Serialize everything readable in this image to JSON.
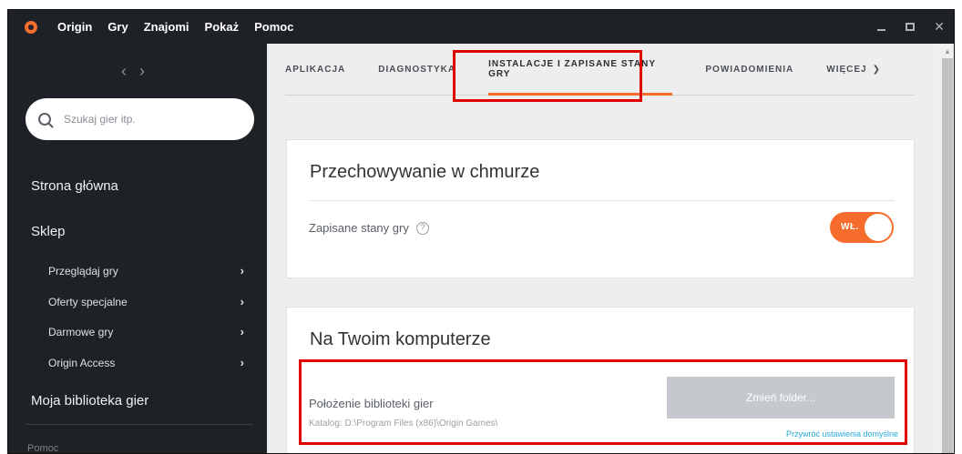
{
  "menu": {
    "items": [
      "Origin",
      "Gry",
      "Znajomi",
      "Pokaż",
      "Pomoc"
    ]
  },
  "sidebar": {
    "search_placeholder": "Szukaj gier itp.",
    "home": "Strona główna",
    "store": "Sklep",
    "store_items": [
      {
        "label": "Przeglądaj gry"
      },
      {
        "label": "Oferty specjalne"
      },
      {
        "label": "Darmowe gry"
      },
      {
        "label": "Origin Access"
      }
    ],
    "library": "Moja biblioteka gier",
    "help": "Pomoc"
  },
  "tabs": [
    {
      "label": "APLIKACJA"
    },
    {
      "label": "DIAGNOSTYKA"
    },
    {
      "label": "INSTALACJE I ZAPISANE STANY GRY"
    },
    {
      "label": "POWIADOMIENIA"
    },
    {
      "label": "WIĘCEJ"
    }
  ],
  "cloud": {
    "title": "Przechowywanie w chmurze",
    "saves_label": "Zapisane stany gry",
    "toggle_label": "WŁ."
  },
  "local": {
    "title": "Na Twoim komputerze",
    "library_label": "Położenie biblioteki gier",
    "library_path": "Katalog: D:\\Program Files (x86)\\Origin Games\\",
    "change_button": "Zmień folder...",
    "restore_link": "Przywróć ustawienia domyślne"
  },
  "colors": {
    "accent": "#f56c2d",
    "sidebar_bg": "#1e2226",
    "link": "#2aa9d9",
    "highlight": "#e00000"
  }
}
